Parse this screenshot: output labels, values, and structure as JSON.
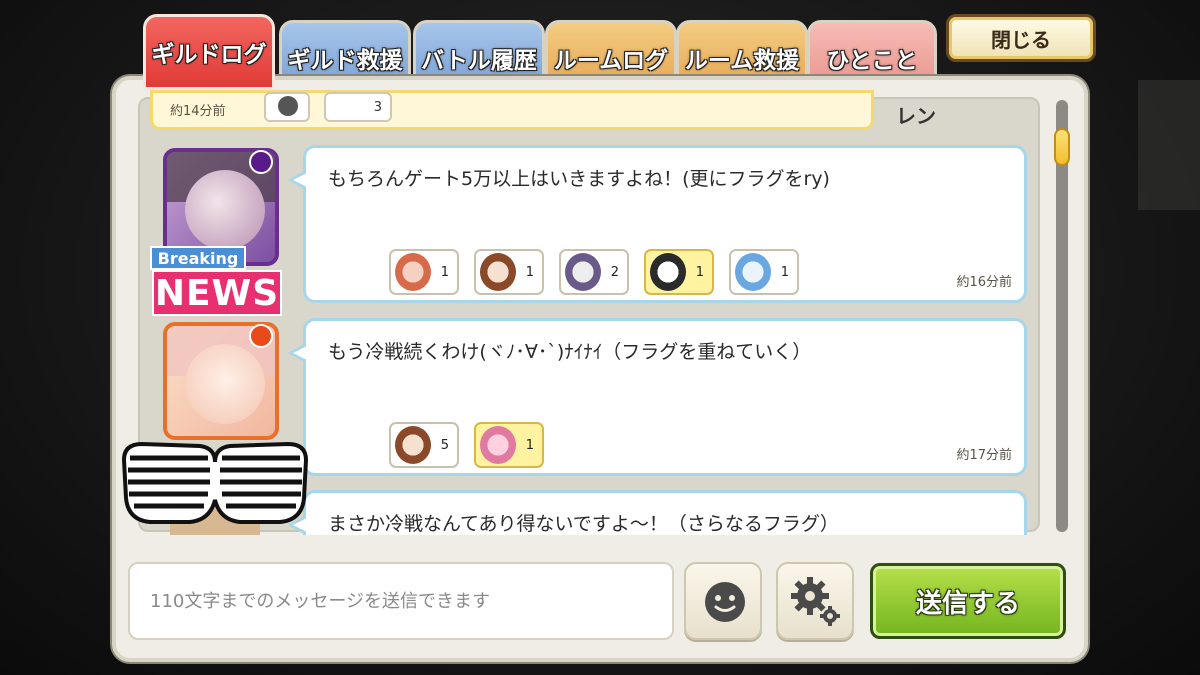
{
  "tabs": [
    {
      "label": "ギルドログ",
      "active": true,
      "color": "#e23a36"
    },
    {
      "label": "ギルド救援",
      "active": false,
      "color": "#7ea3d6"
    },
    {
      "label": "バトル履歴",
      "active": false,
      "color": "#7ea3d6"
    },
    {
      "label": "ルームログ",
      "active": false,
      "color": "#e7aa58"
    },
    {
      "label": "ルーム救援",
      "active": false,
      "color": "#e7aa58"
    },
    {
      "label": "ひとこと",
      "active": false,
      "color": "#ea9890"
    }
  ],
  "close_label": "閉じる",
  "top_entry": {
    "time": "約14分前",
    "react_count": "3",
    "name": "レン"
  },
  "messages": [
    {
      "text": "もちろんゲート5万以上はいきますよね！(更にフラグをry)",
      "time": "約16分前",
      "badges": {
        "breaking": "Breaking",
        "news": "NEWS"
      },
      "reactions": [
        {
          "count": "1",
          "mine": false,
          "color": "#d66a4a"
        },
        {
          "count": "1",
          "mine": false,
          "color": "#8a4a2a"
        },
        {
          "count": "2",
          "mine": false,
          "color": "#6a5a8a"
        },
        {
          "count": "1",
          "mine": true,
          "color": "#2a2a2a"
        },
        {
          "count": "1",
          "mine": false,
          "color": "#6aa6e0"
        }
      ]
    },
    {
      "text": "もう冷戦続くわけ(ヾﾉ･∀･`)ﾅｲﾅｲ（フラグを重ねていく）",
      "time": "約17分前",
      "reactions": [
        {
          "count": "5",
          "mine": false,
          "color": "#8a4a2a"
        },
        {
          "count": "1",
          "mine": true,
          "color": "#e07aa0"
        }
      ]
    },
    {
      "text": "まさか冷戦なんてあり得ないですよ～！（さらなるフラグ）"
    }
  ],
  "input": {
    "placeholder": "110文字までのメッセージを送信できます",
    "value": ""
  },
  "send_label": "送信する",
  "icons": [
    "emoji-icon",
    "gear-icon"
  ]
}
